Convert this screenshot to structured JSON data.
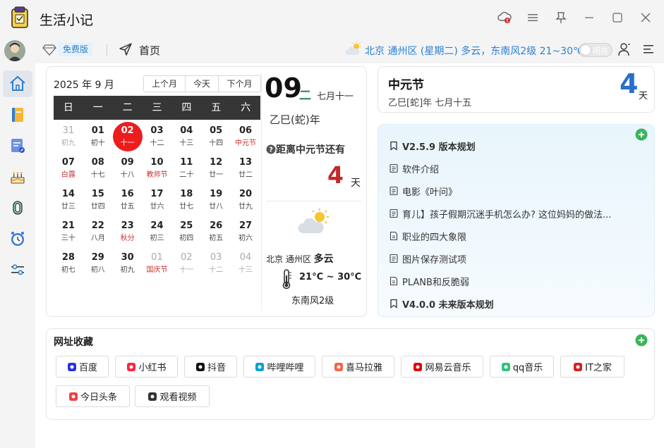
{
  "app": {
    "title": "生活小记"
  },
  "toolbar": {
    "plan_badge": "免费版",
    "home_label": "首页",
    "weather_line": "北京 通州区 (星期二) 多云，东南风2级 21~30℃",
    "theme_label": "明亮"
  },
  "sidebar": {
    "items": [
      {
        "name": "home",
        "icon": "home-icon",
        "active": true
      },
      {
        "name": "notebook",
        "icon": "notebook-icon",
        "active": false
      },
      {
        "name": "notes",
        "icon": "note-edit-icon",
        "active": false
      },
      {
        "name": "birthday",
        "icon": "cake-icon",
        "active": false
      },
      {
        "name": "attachments",
        "icon": "paperclip-icon",
        "active": false
      },
      {
        "name": "reminders",
        "icon": "clock-icon",
        "active": false
      },
      {
        "name": "settings",
        "icon": "sliders-icon",
        "active": false
      }
    ]
  },
  "calendar": {
    "year_month": "2025 年 9 月",
    "nav": {
      "prev": "上个月",
      "today": "今天",
      "next": "下个月"
    },
    "weekdays": [
      "日",
      "一",
      "二",
      "三",
      "四",
      "五",
      "六"
    ],
    "weeks": [
      [
        {
          "d": "31",
          "l": "初九",
          "other": true
        },
        {
          "d": "01",
          "l": "初十"
        },
        {
          "d": "02",
          "l": "十一",
          "today": true
        },
        {
          "d": "03",
          "l": "十二"
        },
        {
          "d": "04",
          "l": "十三"
        },
        {
          "d": "05",
          "l": "十四"
        },
        {
          "d": "06",
          "l": "中元节",
          "fest": true
        }
      ],
      [
        {
          "d": "07",
          "l": "白露",
          "fest": true
        },
        {
          "d": "08",
          "l": "十七"
        },
        {
          "d": "09",
          "l": "十八"
        },
        {
          "d": "10",
          "l": "教师节",
          "fest": true
        },
        {
          "d": "11",
          "l": "二十"
        },
        {
          "d": "12",
          "l": "廿一"
        },
        {
          "d": "13",
          "l": "廿二"
        }
      ],
      [
        {
          "d": "14",
          "l": "廿三"
        },
        {
          "d": "15",
          "l": "廿四"
        },
        {
          "d": "16",
          "l": "廿五"
        },
        {
          "d": "17",
          "l": "廿六"
        },
        {
          "d": "18",
          "l": "廿七"
        },
        {
          "d": "19",
          "l": "廿八"
        },
        {
          "d": "20",
          "l": "廿九"
        }
      ],
      [
        {
          "d": "21",
          "l": "三十"
        },
        {
          "d": "22",
          "l": "八月"
        },
        {
          "d": "23",
          "l": "秋分",
          "fest": true
        },
        {
          "d": "24",
          "l": "初三"
        },
        {
          "d": "25",
          "l": "初四"
        },
        {
          "d": "26",
          "l": "初五"
        },
        {
          "d": "27",
          "l": "初六"
        }
      ],
      [
        {
          "d": "28",
          "l": "初七"
        },
        {
          "d": "29",
          "l": "初八"
        },
        {
          "d": "30",
          "l": "初九"
        },
        {
          "d": "01",
          "l": "国庆节",
          "fest": true,
          "other": true
        },
        {
          "d": "02",
          "l": "十一",
          "other": true
        },
        {
          "d": "03",
          "l": "十二",
          "other": true
        },
        {
          "d": "04",
          "l": "十三",
          "other": true
        }
      ]
    ],
    "selected": {
      "day": "09",
      "weekday": "二",
      "lunar": "七月十一",
      "ganzhi": "乙巳(蛇)年",
      "countdown_label": "距离中元节还有",
      "countdown_days": "4",
      "countdown_unit": "天"
    },
    "weather": {
      "location": "北京 通州区",
      "condition": "多云",
      "temp": "21°C ~ 30°C",
      "wind": "东南风2级"
    }
  },
  "festival": {
    "name": "中元节",
    "date": "乙巳[蛇]年 七月十五",
    "days": "4",
    "unit": "天"
  },
  "notes": [
    {
      "title": "V2.5.9 版本规划",
      "icon": "bookmark-icon",
      "bold": true
    },
    {
      "title": "软件介绍",
      "icon": "note-icon",
      "bold": false
    },
    {
      "title": "电影《叶问》",
      "icon": "note-icon",
      "bold": false
    },
    {
      "title": "育儿】孩子假期沉迷手机怎么办? 这位妈妈的做法...",
      "icon": "note-icon",
      "bold": false
    },
    {
      "title": "职业的四大象限",
      "icon": "doc-icon",
      "bold": false
    },
    {
      "title": "图片保存测试项",
      "icon": "note-icon",
      "bold": false
    },
    {
      "title": "PLANB和反脆弱",
      "icon": "doc-icon",
      "bold": false
    },
    {
      "title": "V4.0.0 未来版本规划",
      "icon": "bookmark-icon",
      "bold": true
    }
  ],
  "bookmarks": {
    "title": "网址收藏",
    "items": [
      {
        "label": "百度",
        "icon": "baidu-icon",
        "color": "#2932e1"
      },
      {
        "label": "小红书",
        "icon": "xiaohongshu-icon",
        "color": "#ff2442"
      },
      {
        "label": "抖音",
        "icon": "douyin-icon",
        "color": "#111111"
      },
      {
        "label": "哔哩哔哩",
        "icon": "bilibili-icon",
        "color": "#00a1d6"
      },
      {
        "label": "喜马拉雅",
        "icon": "ximalaya-icon",
        "color": "#f86442"
      },
      {
        "label": "网易云音乐",
        "icon": "netease-music-icon",
        "color": "#e20000"
      },
      {
        "label": "qq音乐",
        "icon": "qq-music-icon",
        "color": "#31c27c"
      },
      {
        "label": "IT之家",
        "icon": "ithome-icon",
        "color": "#d22222"
      },
      {
        "label": "今日头条",
        "icon": "toutiao-icon",
        "color": "#f04142"
      },
      {
        "label": "观看视频",
        "icon": "video-icon",
        "color": "#333333"
      }
    ]
  },
  "colors": {
    "accent": "#2a7fd4",
    "today": "#ee1c1c",
    "festival": "#c9302c",
    "add": "#3cb55a"
  }
}
